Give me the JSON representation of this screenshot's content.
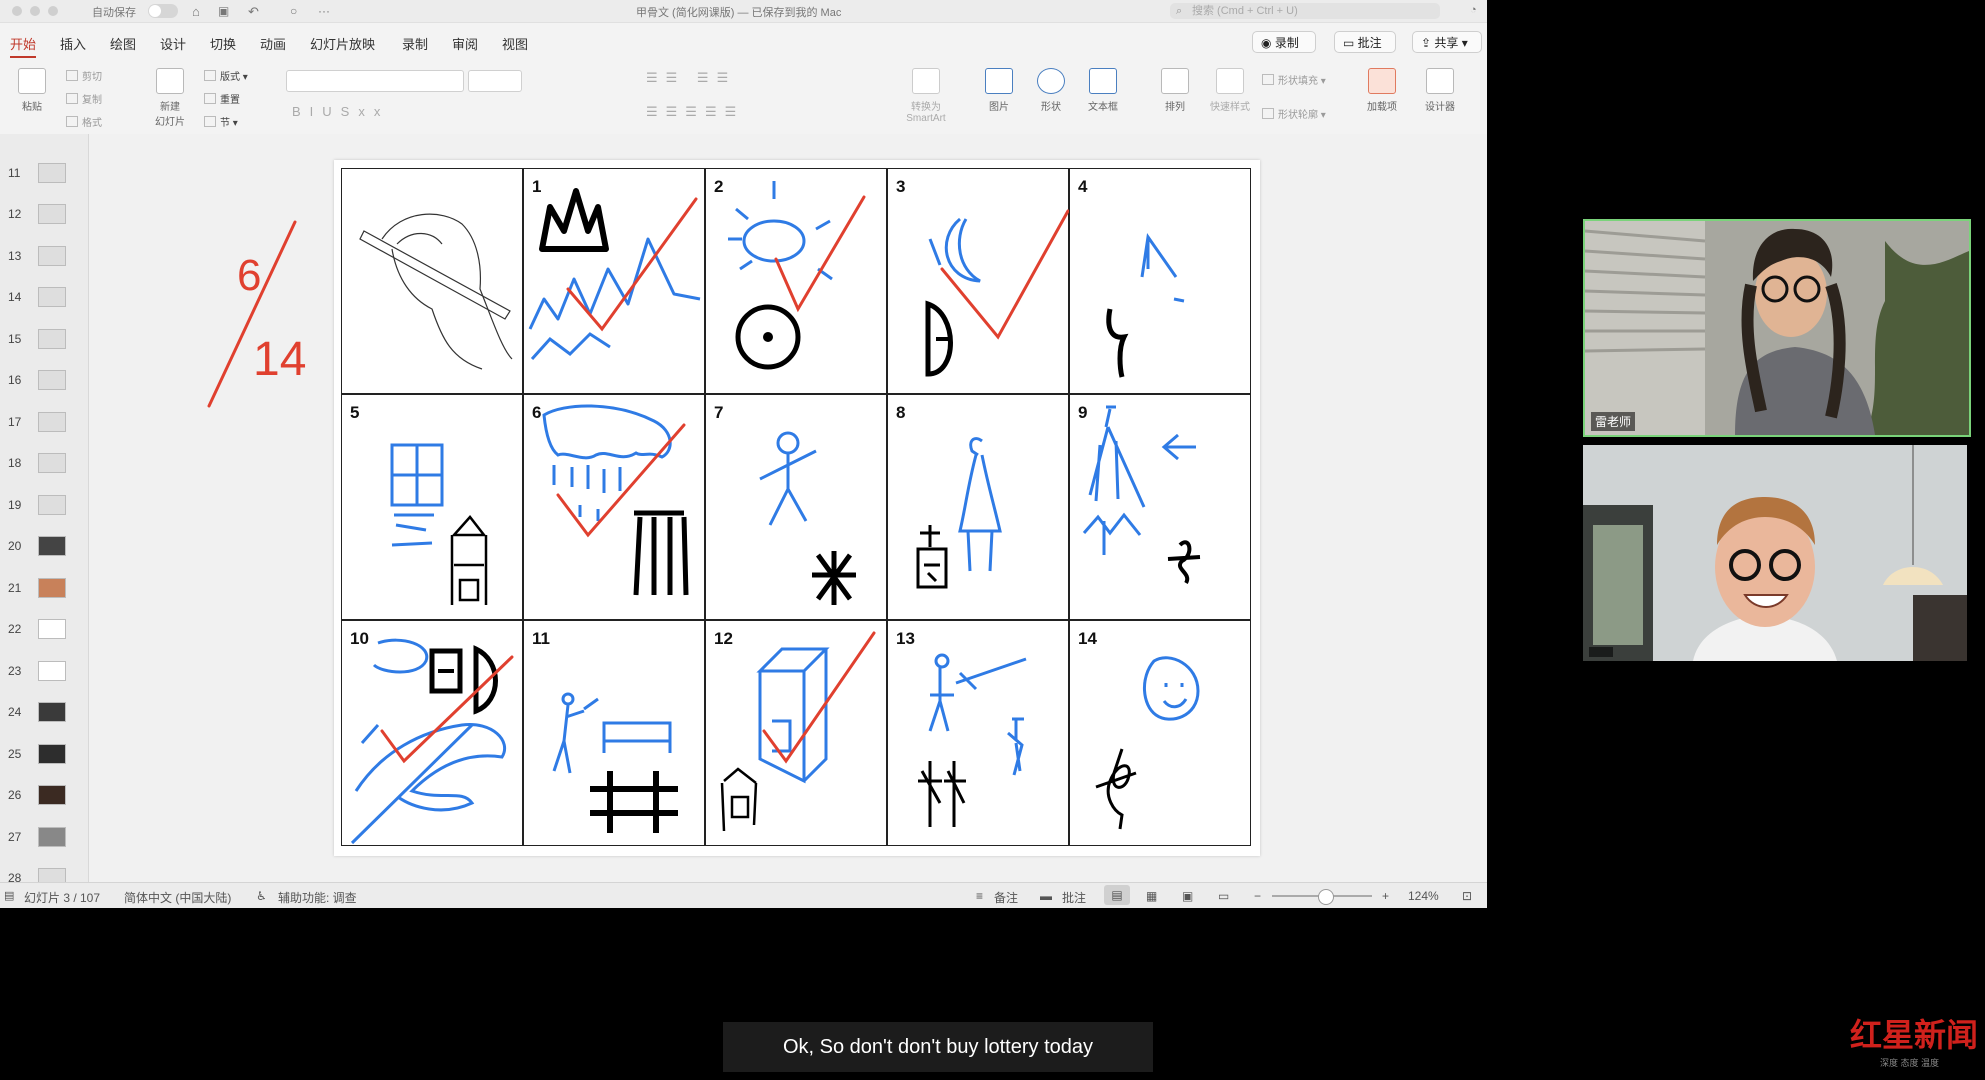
{
  "titlebar": {
    "autosave_label": "自动保存",
    "doc_title": "甲骨文 (简化网课版) — 已保存到我的 Mac",
    "search_placeholder": "搜索 (Cmd + Ctrl + U)"
  },
  "menu": {
    "items": [
      "开始",
      "插入",
      "绘图",
      "设计",
      "切换",
      "动画",
      "幻灯片放映",
      "录制",
      "审阅",
      "视图"
    ],
    "record_button": "录制",
    "comment_button": "批注",
    "share_button": "共享"
  },
  "ribbon": {
    "paste": "粘贴",
    "cut": "剪切",
    "copy": "复制",
    "format": "格式",
    "new_slide_1": "新建",
    "new_slide_2": "幻灯片",
    "layout": "版式",
    "reset": "重置",
    "section": "节",
    "convert_1": "转换为",
    "convert_2": "SmartArt",
    "picture": "图片",
    "shape": "形状",
    "textbox": "文本框",
    "arrange": "排列",
    "quick_styles": "快速样式",
    "shape_fill": "形状填充",
    "shape_outline": "形状轮廓",
    "addins": "加载项",
    "designer": "设计器"
  },
  "sidebar": {
    "slide_numbers": [
      "11",
      "12",
      "13",
      "14",
      "15",
      "16",
      "17",
      "18",
      "19",
      "20",
      "21",
      "22",
      "23",
      "24",
      "25",
      "26",
      "27",
      "28"
    ]
  },
  "annotation": {
    "score_top": "6",
    "score_bottom": "14"
  },
  "grid": {
    "cell_numbers": [
      "1",
      "2",
      "3",
      "4",
      "5",
      "6",
      "7",
      "8",
      "9",
      "10",
      "11",
      "12",
      "13",
      "14"
    ]
  },
  "statusbar": {
    "slide_counter": "幻灯片 3 / 107",
    "language": "简体中文 (中国大陆)",
    "accessibility": "辅助功能: 调查",
    "notes": "备注",
    "comments": "批注",
    "zoom": "124%"
  },
  "video": {
    "participant_1_name": "雷老师"
  },
  "subtitle": {
    "text": "Ok,  So don't don't buy lottery today"
  },
  "watermark": {
    "brand": "红星新闻",
    "tagline": "深度 态度 温度"
  },
  "colors": {
    "accent": "#c0392b",
    "ink_blue": "#2f7be5",
    "ink_red": "#e0402f"
  }
}
